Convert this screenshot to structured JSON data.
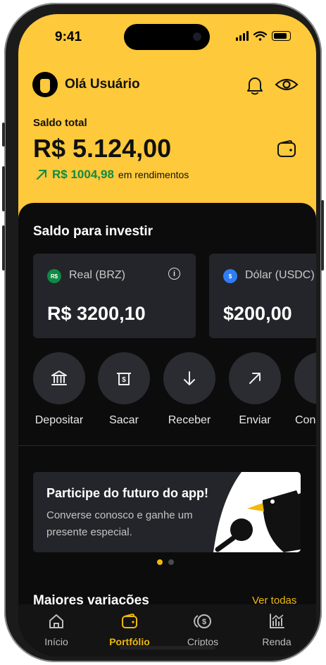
{
  "status": {
    "time": "9:41"
  },
  "header": {
    "greeting": "Olá Usuário",
    "bell_icon": "bell-icon",
    "eye_icon": "eye-icon"
  },
  "balance": {
    "label": "Saldo total",
    "value": "R$ 5.124,00",
    "earnings_value": "R$ 1004,98",
    "earnings_text": "em rendimentos"
  },
  "invest": {
    "title": "Saldo para investir",
    "cards": [
      {
        "coin": "R$",
        "coin_color": "#0f8a44",
        "name": "Real (BRZ)",
        "amount": "R$ 3200,10"
      },
      {
        "coin": "$",
        "coin_color": "#2f7df6",
        "name": "Dólar (USDC)",
        "amount": "$200,00"
      }
    ]
  },
  "actions": [
    {
      "label": "Depositar",
      "icon": "bank-icon"
    },
    {
      "label": "Sacar",
      "icon": "withdraw-icon"
    },
    {
      "label": "Receber",
      "icon": "arrow-down-icon"
    },
    {
      "label": "Enviar",
      "icon": "arrow-up-right-icon"
    },
    {
      "label": "Con",
      "icon": "convert-icon"
    }
  ],
  "banner": {
    "title": "Participe do futuro do app!",
    "subtitle": "Converse conosco e ganhe um presente especial."
  },
  "carousel": {
    "pages": 2,
    "active": 1
  },
  "movers": {
    "title": "Maiores variações",
    "see_all": "Ver todas"
  },
  "tabs": [
    {
      "label": "Início",
      "icon": "home-icon"
    },
    {
      "label": "Portfólio",
      "icon": "wallet-icon",
      "active": true
    },
    {
      "label": "Criptos",
      "icon": "coin-icon"
    },
    {
      "label": "Renda",
      "icon": "chart-icon"
    }
  ],
  "colors": {
    "brand_yellow": "#fec93a",
    "accent_gold": "#f0b90b",
    "positive_green": "#0f8a44",
    "dark_bg": "#0c0c0c",
    "card_bg": "#23252a"
  }
}
